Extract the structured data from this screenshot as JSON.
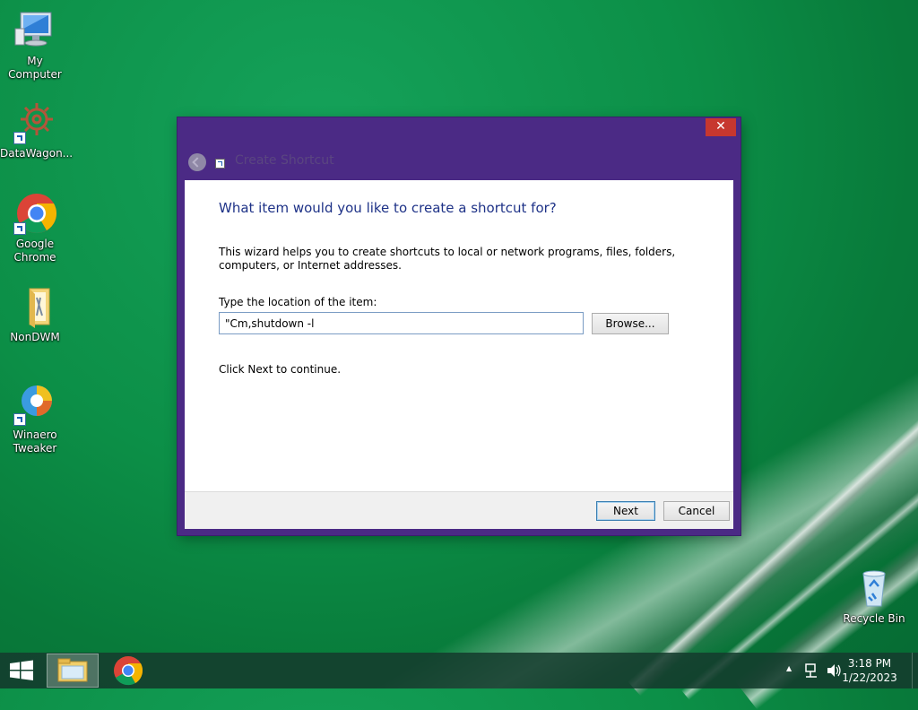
{
  "desktop": {
    "icons": [
      {
        "label": "My Computer"
      },
      {
        "label": "DataWagon..."
      },
      {
        "label": "Google Chrome"
      },
      {
        "label": "NonDWM"
      },
      {
        "label": "Winaero Tweaker"
      },
      {
        "label": "Recycle Bin"
      }
    ]
  },
  "dialog": {
    "title": "Create Shortcut",
    "close_label": "✕",
    "heading": "What item would you like to create a shortcut for?",
    "description": "This wizard helps you to create shortcuts to local or network programs, files, folders, computers, or Internet addresses.",
    "location_label": "Type the location of the item:",
    "location_value": "\"Cm,shutdown -l",
    "browse_label": "Browse...",
    "continue_text": "Click Next to continue.",
    "next_label": "Next",
    "cancel_label": "Cancel"
  },
  "taskbar": {
    "time": "3:18 PM",
    "date": "1/22/2023",
    "tray_overflow": "▲"
  },
  "colors": {
    "dialog_frame": "#4b2a85",
    "heading": "#1e3287",
    "close": "#c7372f",
    "desktop": "#0c8f47"
  }
}
